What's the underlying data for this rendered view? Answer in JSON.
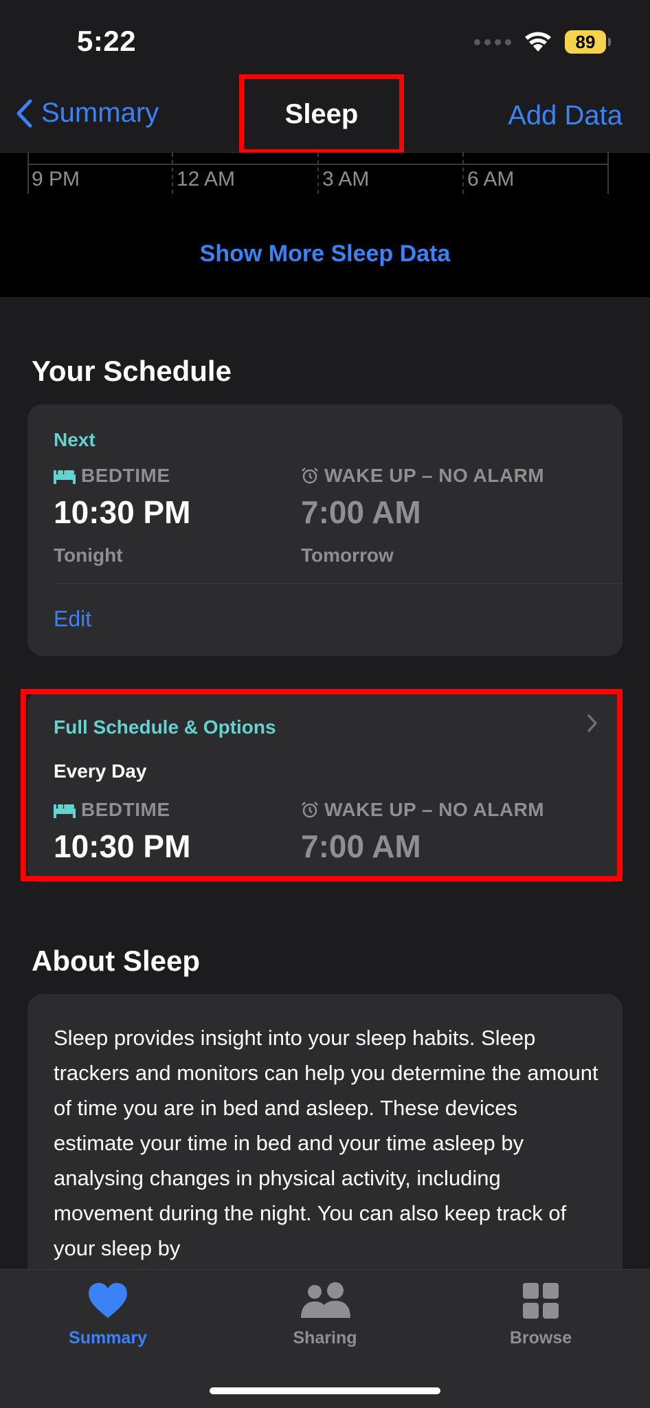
{
  "status": {
    "time": "5:22",
    "battery": "89"
  },
  "nav": {
    "back_label": "Summary",
    "title": "Sleep",
    "action": "Add Data"
  },
  "chart": {
    "ticks": [
      "9 PM",
      "12 AM",
      "3 AM",
      "6 AM"
    ],
    "show_more": "Show More Sleep Data"
  },
  "schedule": {
    "header": "Your Schedule",
    "next": {
      "label": "Next",
      "bedtime_label": "BEDTIME",
      "bedtime": "10:30 PM",
      "bedtime_day": "Tonight",
      "wake_label": "WAKE UP – NO ALARM",
      "wake": "7:00 AM",
      "wake_day": "Tomorrow",
      "edit": "Edit"
    },
    "full": {
      "label": "Full Schedule & Options",
      "frequency": "Every Day",
      "bedtime_label": "BEDTIME",
      "bedtime": "10:30 PM",
      "wake_label": "WAKE UP – NO ALARM",
      "wake": "7:00 AM"
    }
  },
  "about": {
    "header": "About Sleep",
    "text": "Sleep provides insight into your sleep habits. Sleep trackers and monitors can help you determine the amount of time you are in bed and asleep. These devices estimate your time in bed and your time asleep by analysing changes in physical activity, including movement during the night. You can also keep track of your sleep by"
  },
  "tabs": [
    {
      "label": "Summary",
      "icon": "heart-icon",
      "active": true
    },
    {
      "label": "Sharing",
      "icon": "people-icon",
      "active": false
    },
    {
      "label": "Browse",
      "icon": "grid-icon",
      "active": false
    }
  ],
  "colors": {
    "accent": "#3b82f6",
    "teal": "#64d2d0",
    "highlight": "#ff0000",
    "background": "#1c1c1e",
    "card": "#2c2c2e"
  }
}
